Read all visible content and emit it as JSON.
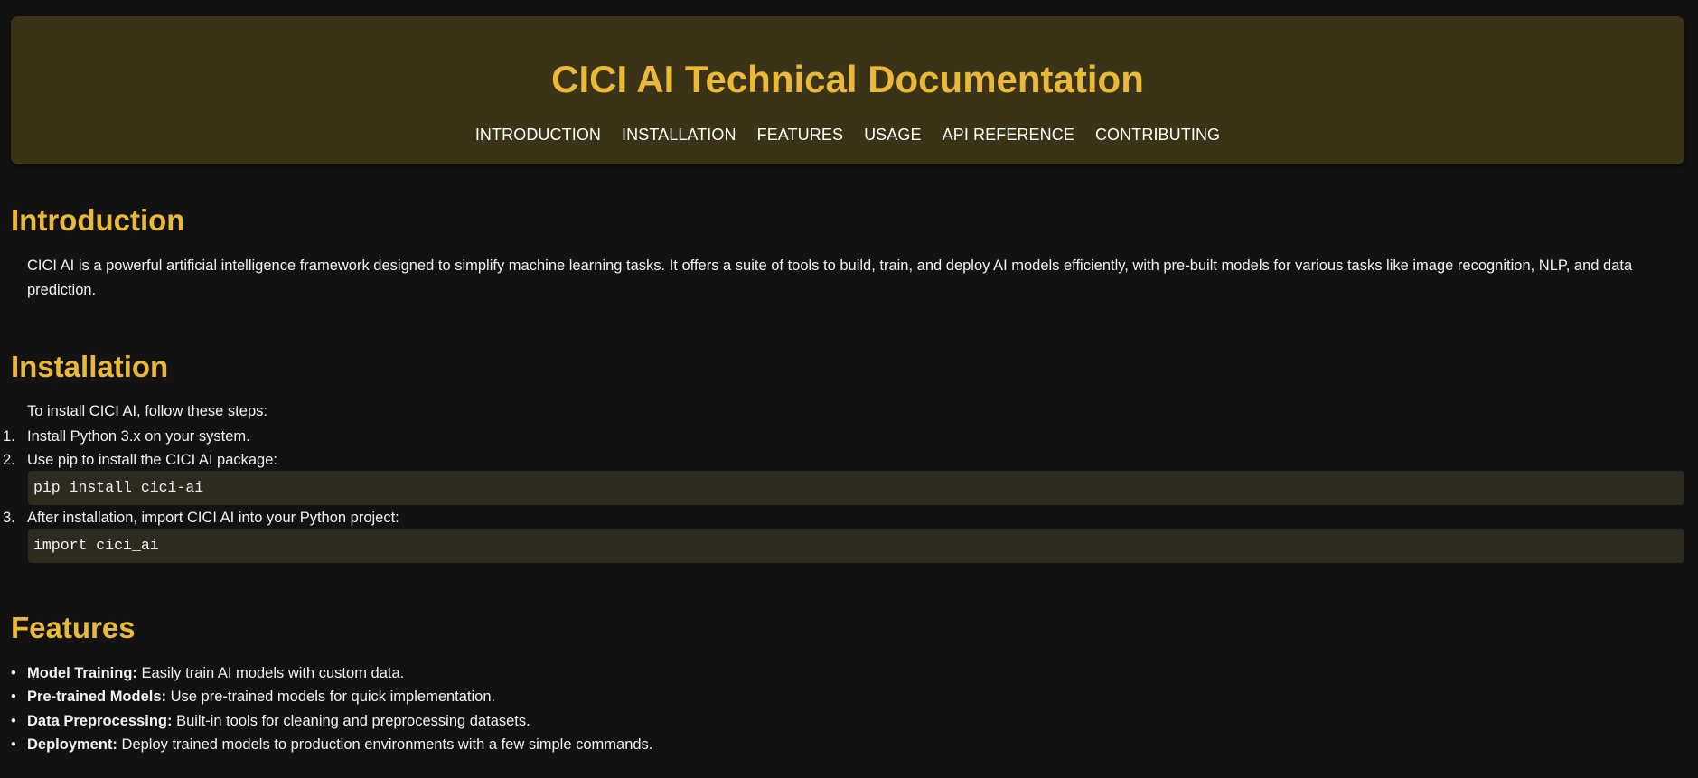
{
  "header": {
    "title": "CICI AI Technical Documentation",
    "nav": [
      "INTRODUCTION",
      "INSTALLATION",
      "FEATURES",
      "USAGE",
      "API REFERENCE",
      "CONTRIBUTING"
    ]
  },
  "introduction": {
    "title": "Introduction",
    "text": "CICI AI is a powerful artificial intelligence framework designed to simplify machine learning tasks. It offers a suite of tools to build, train, and deploy AI models efficiently, with pre-built models for various tasks like image recognition, NLP, and data prediction."
  },
  "installation": {
    "title": "Installation",
    "intro": "To install CICI AI, follow these steps:",
    "steps": [
      {
        "num": "1.",
        "text": "Install Python 3.x on your system."
      },
      {
        "num": "2.",
        "text": "Use pip to install the CICI AI package:",
        "code": "pip install cici-ai"
      },
      {
        "num": "3.",
        "text": "After installation, import CICI AI into your Python project:",
        "code": "import cici_ai"
      }
    ]
  },
  "features": {
    "title": "Features",
    "bullet": "•",
    "items": [
      {
        "label": "Model Training:",
        "text": "Easily train AI models with custom data."
      },
      {
        "label": "Pre-trained Models:",
        "text": "Use pre-trained models for quick implementation."
      },
      {
        "label": "Data Preprocessing:",
        "text": "Built-in tools for cleaning and preprocessing datasets."
      },
      {
        "label": "Deployment:",
        "text": "Deploy trained models to production environments with a few simple commands."
      }
    ]
  },
  "colors": {
    "background": "#121212",
    "header_bg": "#3a3318",
    "accent": "#eab93a",
    "code_bg": "#2d2a20"
  }
}
